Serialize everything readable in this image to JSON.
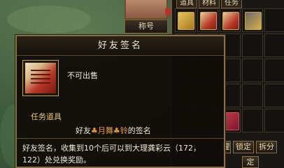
{
  "character": {
    "title_label": "称号"
  },
  "inventory": {
    "tabs": [
      "道具",
      "材料",
      "任务"
    ],
    "slots": [
      {
        "icon": "gold-token-icon"
      },
      {
        "icon": "red-scroll-icon"
      },
      {
        "icon": "red-scroll-icon"
      },
      {
        "icon": "gold-hammer-icon"
      },
      {
        "icon": "empty"
      },
      {
        "icon": "empty"
      },
      {
        "icon": "signature-scroll-icon"
      }
    ],
    "lock_label": "锁定",
    "split_label": "拆分",
    "sort_label": "理",
    "lock_small_label": "定"
  },
  "tooltip": {
    "title": "好友签名",
    "icon": "signature-scroll-icon",
    "no_sell": "不可出售",
    "item_type": "任务道具",
    "signature_prefix": "好友",
    "signature_name": "♣月舞♣铃",
    "signature_suffix": "的签名",
    "description": "好友签名，收集到10个后可以到大理龚彩云（172，122）处兑换奖励。"
  }
}
